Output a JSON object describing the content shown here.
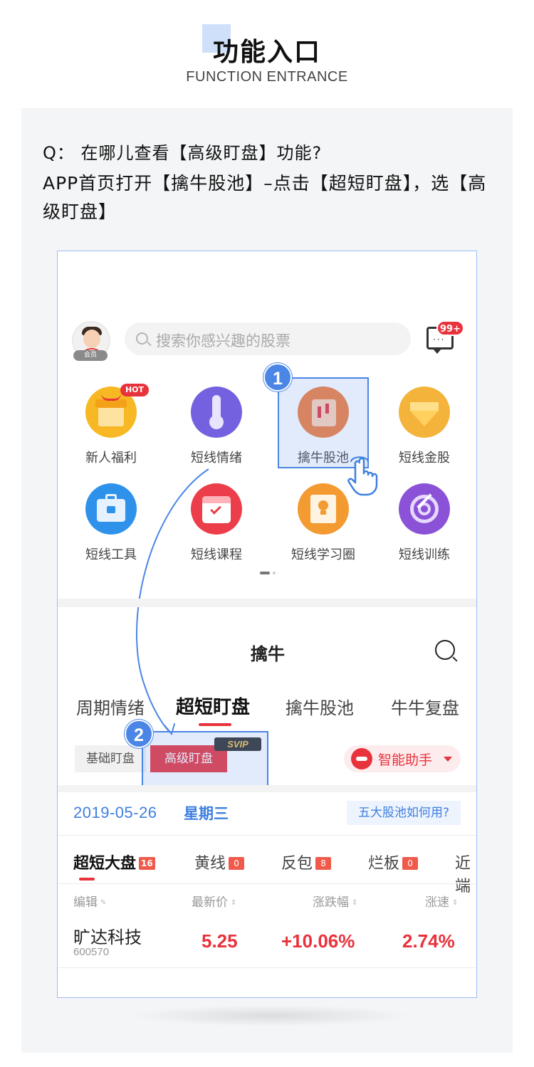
{
  "header": {
    "title": "功能入口",
    "subtitle": "FUNCTION ENTRANCE"
  },
  "panel": {
    "question": "Q：  在哪儿查看【高级盯盘】功能?",
    "answer": "APP首页打开【擒牛股池】–点击【超短盯盘】，选【高级盯盘】"
  },
  "home": {
    "member_badge": "会员",
    "search_placeholder": "搜索你感兴趣的股票",
    "message_badge": "99+",
    "hot_badge": "HOT",
    "grid": [
      {
        "label": "新人福利",
        "icon": "gift-icon",
        "color": "#f5b21a"
      },
      {
        "label": "短线情绪",
        "icon": "thermometer-icon",
        "color": "#6f5bd8"
      },
      {
        "label": "擒牛股池",
        "icon": "candlestick-icon",
        "color": "#f07a3a"
      },
      {
        "label": "短线金股",
        "icon": "diamond-icon",
        "color": "#f2b43a"
      },
      {
        "label": "短线工具",
        "icon": "toolbox-icon",
        "color": "#2f8ee8"
      },
      {
        "label": "短线课程",
        "icon": "calendar-icon",
        "color": "#ea3b48"
      },
      {
        "label": "短线学习圈",
        "icon": "lightbulb-icon",
        "color": "#f29a2e"
      },
      {
        "label": "短线训练",
        "icon": "target-icon",
        "color": "#8a4fd6"
      }
    ],
    "step1": "1",
    "step2": "2"
  },
  "qinniu": {
    "title": "擒牛",
    "tabs": [
      "周期情绪",
      "超短盯盘",
      "擒牛股池",
      "牛牛复盘"
    ],
    "active_tab": "超短盯盘",
    "chip_basic": "基础盯盘",
    "chip_advanced": "高级盯盘",
    "svip": "SVIP",
    "assistant": "智能助手",
    "date": "2019-05-26",
    "weekday": "星期三",
    "howto": "五大股池如何用?",
    "subtabs": [
      {
        "label": "超短大盘",
        "count": "16"
      },
      {
        "label": "黄线",
        "count": "0"
      },
      {
        "label": "反包",
        "count": "8"
      },
      {
        "label": "烂板",
        "count": "0"
      },
      {
        "label": "近端",
        "count": ""
      }
    ],
    "columns": [
      "编辑",
      "最新价",
      "涨跌幅",
      "涨速"
    ],
    "rows": [
      {
        "name": "旷达科技",
        "code": "600570",
        "price": "5.25",
        "change": "+10.06%",
        "speed": "2.74%"
      }
    ]
  },
  "colors": {
    "accent_blue": "#4b86e6",
    "brand_red": "#e8323c"
  }
}
